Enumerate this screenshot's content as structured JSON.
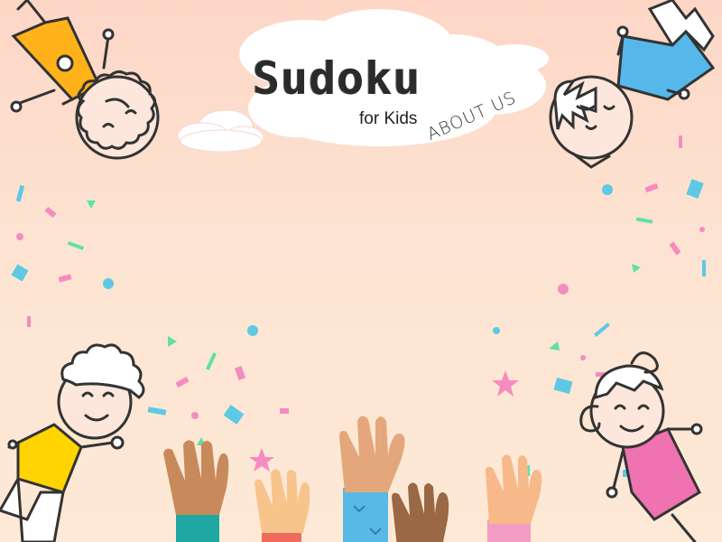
{
  "app": {
    "title": "Sudoku",
    "subtitle": "for Kids",
    "nav_about": "ABOUT US"
  },
  "colors": {
    "bg_top": "#fdd6c6",
    "bg_bottom": "#fde9d6",
    "outline": "#333333",
    "confetti_pink": "#f48cc0",
    "confetti_blue": "#5ec9e3",
    "confetti_green": "#5fe0a6",
    "shirt_yellow": "#ffd400",
    "shirt_blue": "#56b8ea",
    "shirt_orange": "#ffb21a",
    "dress_pink": "#ef72b1"
  },
  "icons": [
    "cloud-icon",
    "confetti-icon",
    "star-icon",
    "hand-icon",
    "kid-illustration"
  ]
}
